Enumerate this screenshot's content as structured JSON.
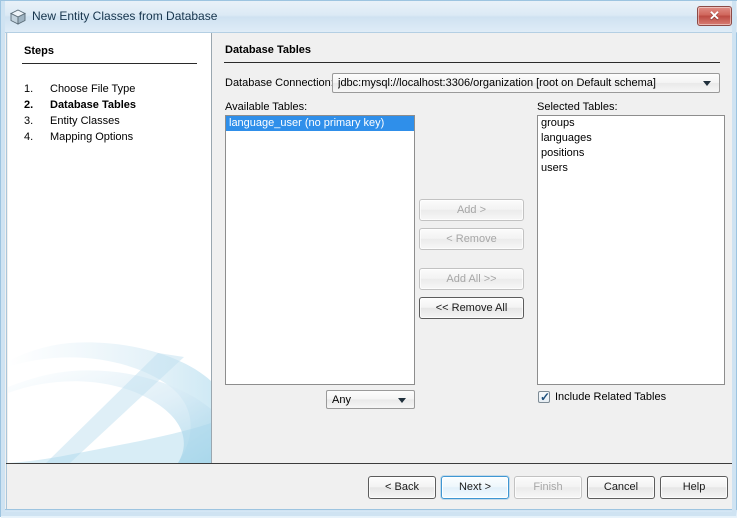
{
  "window": {
    "title": "New Entity Classes from Database",
    "icon": "cube-icon",
    "close_label": "✕"
  },
  "steps": {
    "heading": "Steps",
    "items": [
      {
        "num": "1.",
        "label": "Choose File Type",
        "current": false
      },
      {
        "num": "2.",
        "label": "Database Tables",
        "current": true
      },
      {
        "num": "3.",
        "label": "Entity Classes",
        "current": false
      },
      {
        "num": "4.",
        "label": "Mapping Options",
        "current": false
      }
    ]
  },
  "main": {
    "heading": "Database Tables",
    "connection_label": "Database Connection:",
    "connection_value": "jdbc:mysql://localhost:3306/organization [root on Default schema]",
    "available_label": "Available Tables:",
    "selected_label": "Selected Tables:",
    "available_tables": [
      {
        "name": "language_user (no primary key)",
        "selected": true
      }
    ],
    "selected_tables": [
      {
        "name": "groups",
        "selected": false
      },
      {
        "name": "languages",
        "selected": false
      },
      {
        "name": "positions",
        "selected": false
      },
      {
        "name": "users",
        "selected": false
      }
    ],
    "filter_value": "Any",
    "transfer_buttons": [
      {
        "label": "Add >",
        "enabled": false
      },
      {
        "label": "< Remove",
        "enabled": false
      },
      {
        "label": "Add All >>",
        "enabled": false
      },
      {
        "label": "<< Remove All",
        "enabled": true
      }
    ],
    "include_related_label": "Include Related Tables",
    "include_related_checked": true,
    "checkmark": "✓"
  },
  "footer": {
    "back_label": "< Back",
    "next_label": "Next >",
    "finish_label": "Finish",
    "cancel_label": "Cancel",
    "help_label": "Help"
  },
  "colors": {
    "selection_blue": "#2f8fea",
    "titlebar_blue": "#cfe2f1",
    "close_red": "#bd4a42",
    "focus_blue": "#3f97d3"
  }
}
